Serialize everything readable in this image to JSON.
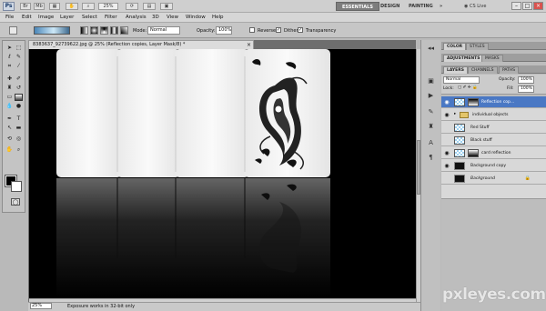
{
  "titlebar": {
    "app_logo": "Ps",
    "zoom": "25%",
    "workspaces": [
      "ESSENTIALS",
      "DESIGN",
      "PAINTING"
    ],
    "cs_live": "CS Live"
  },
  "menu": [
    "File",
    "Edit",
    "Image",
    "Layer",
    "Select",
    "Filter",
    "Analysis",
    "3D",
    "View",
    "Window",
    "Help"
  ],
  "options": {
    "mode_label": "Mode:",
    "mode_value": "Normal",
    "opacity_label": "Opacity:",
    "opacity_value": "100%",
    "reverse_label": "Reverse",
    "dither_label": "Dither",
    "transparency_label": "Transparency",
    "reverse_checked": false,
    "dither_checked": true,
    "transparency_checked": true
  },
  "document": {
    "tab_title": "8383637_92739622.jpg @ 25% (Reflection copies, Layer Mask/8) *",
    "zoom": "25%",
    "status": "Exposure works in 32-bit only"
  },
  "panels": {
    "top_tabs": [
      "COLOR",
      "STYLES"
    ],
    "mid_tabs": [
      "ADJUSTMENTS",
      "MASKS"
    ],
    "layer_tabs": [
      "LAYERS",
      "CHANNELS",
      "PATHS"
    ],
    "blend_mode": "Normal",
    "opacity_label": "Opacity:",
    "opacity_value": "100%",
    "lock_label": "Lock:",
    "fill_label": "Fill:",
    "fill_value": "100%"
  },
  "layers": [
    {
      "name": "Reflection cop...",
      "selected": true,
      "visible": true,
      "type": "masked"
    },
    {
      "name": "individual objects",
      "selected": false,
      "visible": true,
      "type": "group"
    },
    {
      "name": "Red Stuff",
      "selected": false,
      "visible": false,
      "type": "checker"
    },
    {
      "name": "Black stuff",
      "selected": false,
      "visible": false,
      "type": "checker"
    },
    {
      "name": "card reflection",
      "selected": false,
      "visible": true,
      "type": "masked"
    },
    {
      "name": "Background copy",
      "selected": false,
      "visible": true,
      "type": "dark"
    },
    {
      "name": "Background",
      "selected": false,
      "visible": false,
      "type": "dark",
      "locked": true
    }
  ],
  "watermark": "pxleyes.com",
  "colors": {
    "selected_layer": "#4a78c4",
    "canvas": "#000000",
    "panel_bg": "#bcbcbc"
  }
}
